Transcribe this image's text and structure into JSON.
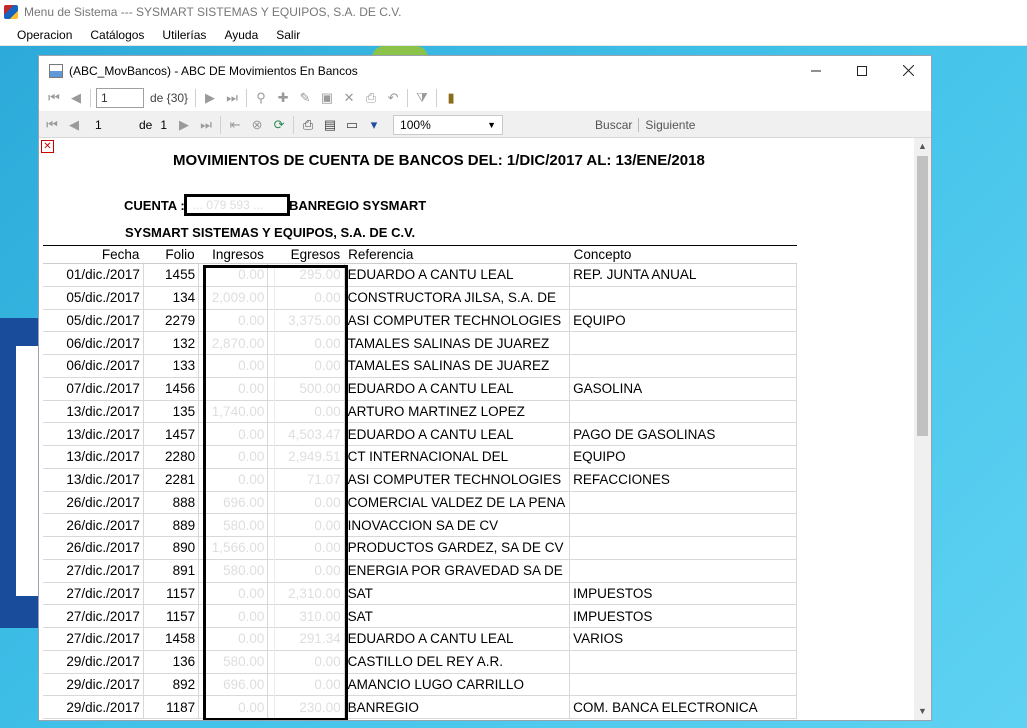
{
  "app": {
    "title": "Menu de Sistema --- SYSMART SISTEMAS Y EQUIPOS, S.A. DE C.V.",
    "menu": [
      "Operacion",
      "Catálogos",
      "Utilerías",
      "Ayuda",
      "Salir"
    ]
  },
  "window": {
    "title": "(ABC_MovBancos) - ABC DE Movimientos En Bancos"
  },
  "navigator": {
    "current_record": "1",
    "record_total": "de {30}"
  },
  "report_toolbar": {
    "page": "1",
    "of_label": "de",
    "total_pages": "1",
    "zoom": "100%",
    "find_label": "Buscar",
    "next_label": "Siguiente"
  },
  "report": {
    "title": "MOVIMIENTOS DE CUENTA DE BANCOS DEL: 1/DIC/2017 AL: 13/ENE/2018",
    "cuenta_label": "CUENTA :",
    "cuenta_number": "... 079 593 ...",
    "bank_name": "BANREGIO SYSMART",
    "company": "SYSMART SISTEMAS Y EQUIPOS, S.A. DE C.V.",
    "columns": [
      "Fecha",
      "Folio",
      "Ingresos",
      "Egresos",
      "Referencia",
      "Concepto"
    ],
    "rows": [
      [
        "01/dic./2017",
        "1455",
        "0.00",
        "295.00",
        "EDUARDO A CANTU LEAL",
        "REP. JUNTA ANUAL"
      ],
      [
        "05/dic./2017",
        "134",
        "2,009.00",
        "0.00",
        "CONSTRUCTORA JILSA, S.A. DE",
        ""
      ],
      [
        "05/dic./2017",
        "2279",
        "0.00",
        "3,375.00",
        "ASI COMPUTER TECHNOLOGIES",
        "EQUIPO"
      ],
      [
        "06/dic./2017",
        "132",
        "2,870.00",
        "0.00",
        "TAMALES SALINAS DE JUAREZ",
        ""
      ],
      [
        "06/dic./2017",
        "133",
        "0.00",
        "0.00",
        "TAMALES SALINAS DE JUAREZ",
        ""
      ],
      [
        "07/dic./2017",
        "1456",
        "0.00",
        "500.00",
        "EDUARDO A CANTU LEAL",
        "GASOLINA"
      ],
      [
        "13/dic./2017",
        "135",
        "1,740.00",
        "0.00",
        "ARTURO MARTINEZ LOPEZ",
        ""
      ],
      [
        "13/dic./2017",
        "1457",
        "0.00",
        "4,503.47",
        "EDUARDO A CANTU LEAL",
        "PAGO DE GASOLINAS"
      ],
      [
        "13/dic./2017",
        "2280",
        "0.00",
        "2,949.51",
        "CT INTERNACIONAL DEL",
        "EQUIPO"
      ],
      [
        "13/dic./2017",
        "2281",
        "0.00",
        "71.07",
        "ASI COMPUTER TECHNOLOGIES",
        "REFACCIONES"
      ],
      [
        "26/dic./2017",
        "888",
        "696.00",
        "0.00",
        "COMERCIAL VALDEZ DE LA PENA",
        ""
      ],
      [
        "26/dic./2017",
        "889",
        "580.00",
        "0.00",
        "INOVACCION SA DE CV",
        ""
      ],
      [
        "26/dic./2017",
        "890",
        "1,566.00",
        "0.00",
        "PRODUCTOS GARDEZ, SA DE CV",
        ""
      ],
      [
        "27/dic./2017",
        "891",
        "580.00",
        "0.00",
        "ENERGIA POR GRAVEDAD SA DE",
        ""
      ],
      [
        "27/dic./2017",
        "1157",
        "0.00",
        "2,310.00",
        "SAT",
        "IMPUESTOS"
      ],
      [
        "27/dic./2017",
        "1157",
        "0.00",
        "310.00",
        "SAT",
        "IMPUESTOS"
      ],
      [
        "27/dic./2017",
        "1458",
        "0.00",
        "291.34",
        "EDUARDO A CANTU LEAL",
        "VARIOS"
      ],
      [
        "29/dic./2017",
        "136",
        "580.00",
        "0.00",
        "CASTILLO DEL REY A.R.",
        ""
      ],
      [
        "29/dic./2017",
        "892",
        "696.00",
        "0.00",
        "AMANCIO LUGO CARRILLO",
        ""
      ],
      [
        "29/dic./2017",
        "1187",
        "0.00",
        "230.00",
        "BANREGIO",
        "COM. BANCA ELECTRONICA"
      ]
    ]
  }
}
